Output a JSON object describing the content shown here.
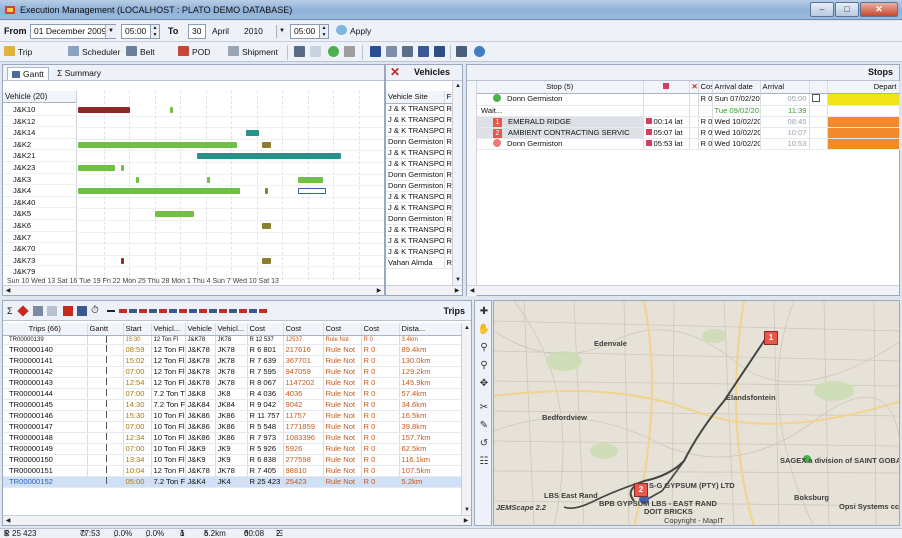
{
  "window": {
    "title": "Execution Management (LOCALHOST : PLATO DEMO DATABASE)"
  },
  "toolbar1": {
    "from_label": "From",
    "from_date": "01 December 2009",
    "from_time": "05:00",
    "to_label": "To",
    "to_day": "30",
    "to_month": "April",
    "to_year": "2010",
    "to_time": "05:00",
    "apply": "Apply"
  },
  "toolbar2": {
    "trip": "Trip",
    "scheduler": "Scheduler",
    "belt": "Belt",
    "pod": "POD",
    "shipment": "Shipment"
  },
  "colors": {
    "green": "#6fc045",
    "maroon": "#8b2a26",
    "teal": "#279188",
    "olive": "#8a7f2e",
    "orange": "#f08a2c",
    "yellow": "#f1e21a",
    "red_marker": "#e8574a"
  },
  "gantt": {
    "tab_gantt": "Gantt",
    "tab_summary": "Summary",
    "header": "Vehicle (20)",
    "vehicles": [
      "J&K10",
      "J&K12",
      "J&K14",
      "J&K2",
      "J&K21",
      "J&K23",
      "J&K3",
      "J&K4",
      "J&K40",
      "J&K5",
      "J&K6",
      "J&K7",
      "J&K70",
      "J&K73",
      "J&K79"
    ],
    "timeline": "Sun 10  Wed 13  Sat 16  Tue 19  Fri 22  Mon 25  Thu 28   Mon 1  Thu 4  Sun 7  Wed 10  Sat 13",
    "bars": [
      {
        "row": 0,
        "start": 0.0,
        "end": 0.17,
        "color": "maroon"
      },
      {
        "row": 0,
        "start": 0.3,
        "end": 0.31,
        "color": "green"
      },
      {
        "row": 2,
        "start": 0.55,
        "end": 0.59,
        "color": "teal"
      },
      {
        "row": 3,
        "start": 0.0,
        "end": 0.52,
        "color": "green"
      },
      {
        "row": 3,
        "start": 0.6,
        "end": 0.63,
        "color": "olive"
      },
      {
        "row": 4,
        "start": 0.39,
        "end": 0.86,
        "color": "teal"
      },
      {
        "row": 5,
        "start": 0.0,
        "end": 0.12,
        "color": "green"
      },
      {
        "row": 5,
        "start": 0.14,
        "end": 0.15,
        "color": "green"
      },
      {
        "row": 6,
        "start": 0.19,
        "end": 0.2,
        "color": "green"
      },
      {
        "row": 6,
        "start": 0.42,
        "end": 0.43,
        "color": "green"
      },
      {
        "row": 6,
        "start": 0.72,
        "end": 0.8,
        "color": "green"
      },
      {
        "row": 7,
        "start": 0.0,
        "end": 0.53,
        "color": "green"
      },
      {
        "row": 7,
        "start": 0.61,
        "end": 0.62,
        "color": "olive"
      },
      {
        "row": 7,
        "start": 0.72,
        "end": 0.81,
        "color": "outline"
      },
      {
        "row": 9,
        "start": 0.25,
        "end": 0.38,
        "color": "green"
      },
      {
        "row": 10,
        "start": 0.6,
        "end": 0.63,
        "color": "olive"
      },
      {
        "row": 13,
        "start": 0.14,
        "end": 0.15,
        "color": "maroon"
      },
      {
        "row": 13,
        "start": 0.6,
        "end": 0.63,
        "color": "olive"
      }
    ]
  },
  "vehicles_panel": {
    "title": "Vehicles",
    "col_site": "Vehicle Site",
    "col_f": "F",
    "rows": [
      {
        "site": "J & K TRANSPO",
        "f": "R"
      },
      {
        "site": "J & K TRANSPO",
        "f": "R"
      },
      {
        "site": "J & K TRANSPO",
        "f": "R"
      },
      {
        "site": "Donn Germiston",
        "f": "R"
      },
      {
        "site": "J & K TRANSPO",
        "f": "R"
      },
      {
        "site": "J & K TRANSPO",
        "f": "R"
      },
      {
        "site": "Donn Germiston",
        "f": "R"
      },
      {
        "site": "Donn Germiston",
        "f": "R"
      },
      {
        "site": "J & K TRANSPO",
        "f": "R"
      },
      {
        "site": "J & K TRANSPO",
        "f": "R"
      },
      {
        "site": "Donn Germiston",
        "f": "R"
      },
      {
        "site": "J & K TRANSPO",
        "f": "R"
      },
      {
        "site": "J & K TRANSPO",
        "f": "R"
      },
      {
        "site": "J & K TRANSPO",
        "f": "R"
      },
      {
        "site": "Vahan Almda",
        "f": "R"
      }
    ]
  },
  "stops": {
    "title": "Stops",
    "col_stop": "Stop (5)",
    "col_cost": "Cost",
    "col_arrival_date": "Arrival date",
    "col_arrival": "Arrival",
    "col_depart": "Depart",
    "rows": [
      {
        "num": "",
        "name": "Donn Germiston",
        "flag": "",
        "cost": "R 0",
        "date": "Sun 07/02/201",
        "arrival": "05:00",
        "color": "yellow"
      },
      {
        "num": "",
        "name": "Wait...",
        "flag": "",
        "cost": "",
        "date": "Tue 09/02/201",
        "arrival": "11:39",
        "color": ""
      },
      {
        "num": "1",
        "name": "EMERALD RIDGE",
        "flag": "00:14 lat",
        "cost": "R 0",
        "date": "Wed 10/02/201",
        "arrival": "08:45",
        "color": "orange"
      },
      {
        "num": "2",
        "name": "AMBIENT CONTRACTING SERVIC",
        "flag": "05:07 lat",
        "cost": "R 0",
        "date": "Wed 10/02/201",
        "arrival": "10:07",
        "color": "orange"
      },
      {
        "num": "",
        "name": "Donn Germiston",
        "flag": "05:53 lat",
        "cost": "R 0",
        "date": "Wed 10/02/201",
        "arrival": "10:53",
        "color": "orange"
      }
    ]
  },
  "trips": {
    "title": "Trips",
    "headers": [
      "Trips (66)",
      "Gantt",
      "Start",
      "Vehicl...",
      "Vehicle",
      "Vehicl...",
      "Cost",
      "Cost",
      "Cost",
      "Cost",
      "Dista..."
    ],
    "rows": [
      [
        "TR00000139",
        "",
        "15:30",
        "12 Ton Fl",
        "J&K78",
        "JK78",
        "R 12 537",
        "12537",
        "Rule Not",
        "R 0",
        "3.4km"
      ],
      [
        "TR00000140",
        "",
        "08:59",
        "12 Ton Fl",
        "J&K78",
        "JK78",
        "R 6 801",
        "217616",
        "Rule Not",
        "R 0",
        "89.4km"
      ],
      [
        "TR00000141",
        "",
        "15:02",
        "12 Ton Fl",
        "J&K78",
        "JK78",
        "R 7 639",
        "367701",
        "Rule Not",
        "R 0",
        "130.0km"
      ],
      [
        "TR00000142",
        "",
        "07:00",
        "12 Ton Fl",
        "J&K78",
        "JK78",
        "R 7 595",
        "947059",
        "Rule Not",
        "R 0",
        "129.2km"
      ],
      [
        "TR00000143",
        "",
        "12:54",
        "12 Ton Fl",
        "J&K78",
        "JK78",
        "R 8 067",
        "1147202",
        "Rule Not",
        "R 0",
        "145.9km"
      ],
      [
        "TR00000144",
        "",
        "07:00",
        "7.2 Ton T",
        "J&K8",
        "JK8",
        "R 4 036",
        "4036",
        "Rule Not",
        "R 0",
        "57.4km"
      ],
      [
        "TR00000145",
        "",
        "14:30",
        "7.2 Ton F",
        "J&K84",
        "JK84",
        "R 9 042",
        "9042",
        "Rule Not",
        "R 0",
        "34.6km"
      ],
      [
        "TR00000146",
        "",
        "15:30",
        "10 Ton Fl",
        "J&K86",
        "JK86",
        "R 11 757",
        "11757",
        "Rule Not",
        "R 0",
        "16.5km"
      ],
      [
        "TR00000147",
        "",
        "07:00",
        "10 Ton Fl",
        "J&K86",
        "JK86",
        "R 5 548",
        "1771859",
        "Rule Not",
        "R 0",
        "39.8km"
      ],
      [
        "TR00000148",
        "",
        "12:34",
        "10 Ton Fl",
        "J&K86",
        "JK86",
        "R 7 973",
        "1083396",
        "Rule Not",
        "R 0",
        "157.7km"
      ],
      [
        "TR00000149",
        "",
        "07:00",
        "10 Ton Fl",
        "J&K9",
        "JK9",
        "R 5 926",
        "5926",
        "Rule Not",
        "R 0",
        "62.5km"
      ],
      [
        "TR00000150",
        "",
        "13:34",
        "10 Ton Fl",
        "J&K9",
        "JK9",
        "R 6 838",
        "277598",
        "Rule Not",
        "R 0",
        "116.1km"
      ],
      [
        "TR00000151",
        "",
        "10:04",
        "12 Ton Fl",
        "J&K78",
        "JK78",
        "R 7 405",
        "98810",
        "Rule Not",
        "R 0",
        "107.5km"
      ],
      [
        "TR00000152",
        "",
        "05:00",
        "7.2 Ton F",
        "J&K4",
        "JK4",
        "R 25 423",
        "25423",
        "Rule Not",
        "R 0",
        "5.2km"
      ]
    ]
  },
  "map": {
    "labels": [
      "Edenvale",
      "Elandsfontein",
      "Bedfordview",
      "SAGEX a division of SAINT GOBA",
      "S-G GYPSUM (PTY) LTD",
      "LBS East Rand",
      "BPB GYPSUM LBS - EAST RAND",
      "Boksburg",
      "Opsi Systems cc",
      "DOIT BRICKS",
      "JEMScape 2.2"
    ],
    "copyright": "Copyright - MapIT",
    "markers": [
      "1",
      "2"
    ]
  },
  "status": {
    "cost": "R 25 423",
    "time": "77:53",
    "pct1": "0.0%",
    "pct2": "0.0%",
    "count": "1",
    "dist": "5.2km",
    "dur": "00:08",
    "stops": "2"
  }
}
